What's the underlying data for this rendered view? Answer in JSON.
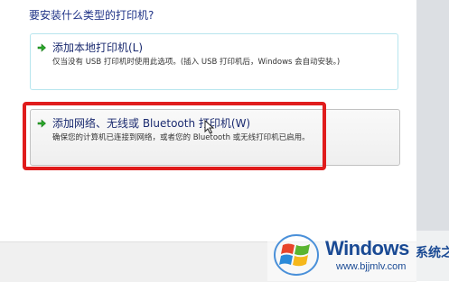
{
  "wizard": {
    "question": "要安装什么类型的打印机?",
    "options": [
      {
        "title": "添加本地打印机(L)",
        "description": "仅当没有 USB 打印机时使用此选项。(插入 USB 打印机后，Windows 会自动安装。)",
        "arrow_icon": "green-arrow-icon"
      },
      {
        "title": "添加网络、无线或 Bluetooth 打印机(W)",
        "description": "确保您的计算机已连接到网络，或者您的 Bluetooth 或无线打印机已启用。",
        "arrow_icon": "green-arrow-icon"
      }
    ]
  },
  "annotation": {
    "highlight_color": "#e01c1c"
  },
  "watermark": {
    "brand": "Windows",
    "suffix": "系统之家",
    "url": "www.bjjmlv.com"
  }
}
